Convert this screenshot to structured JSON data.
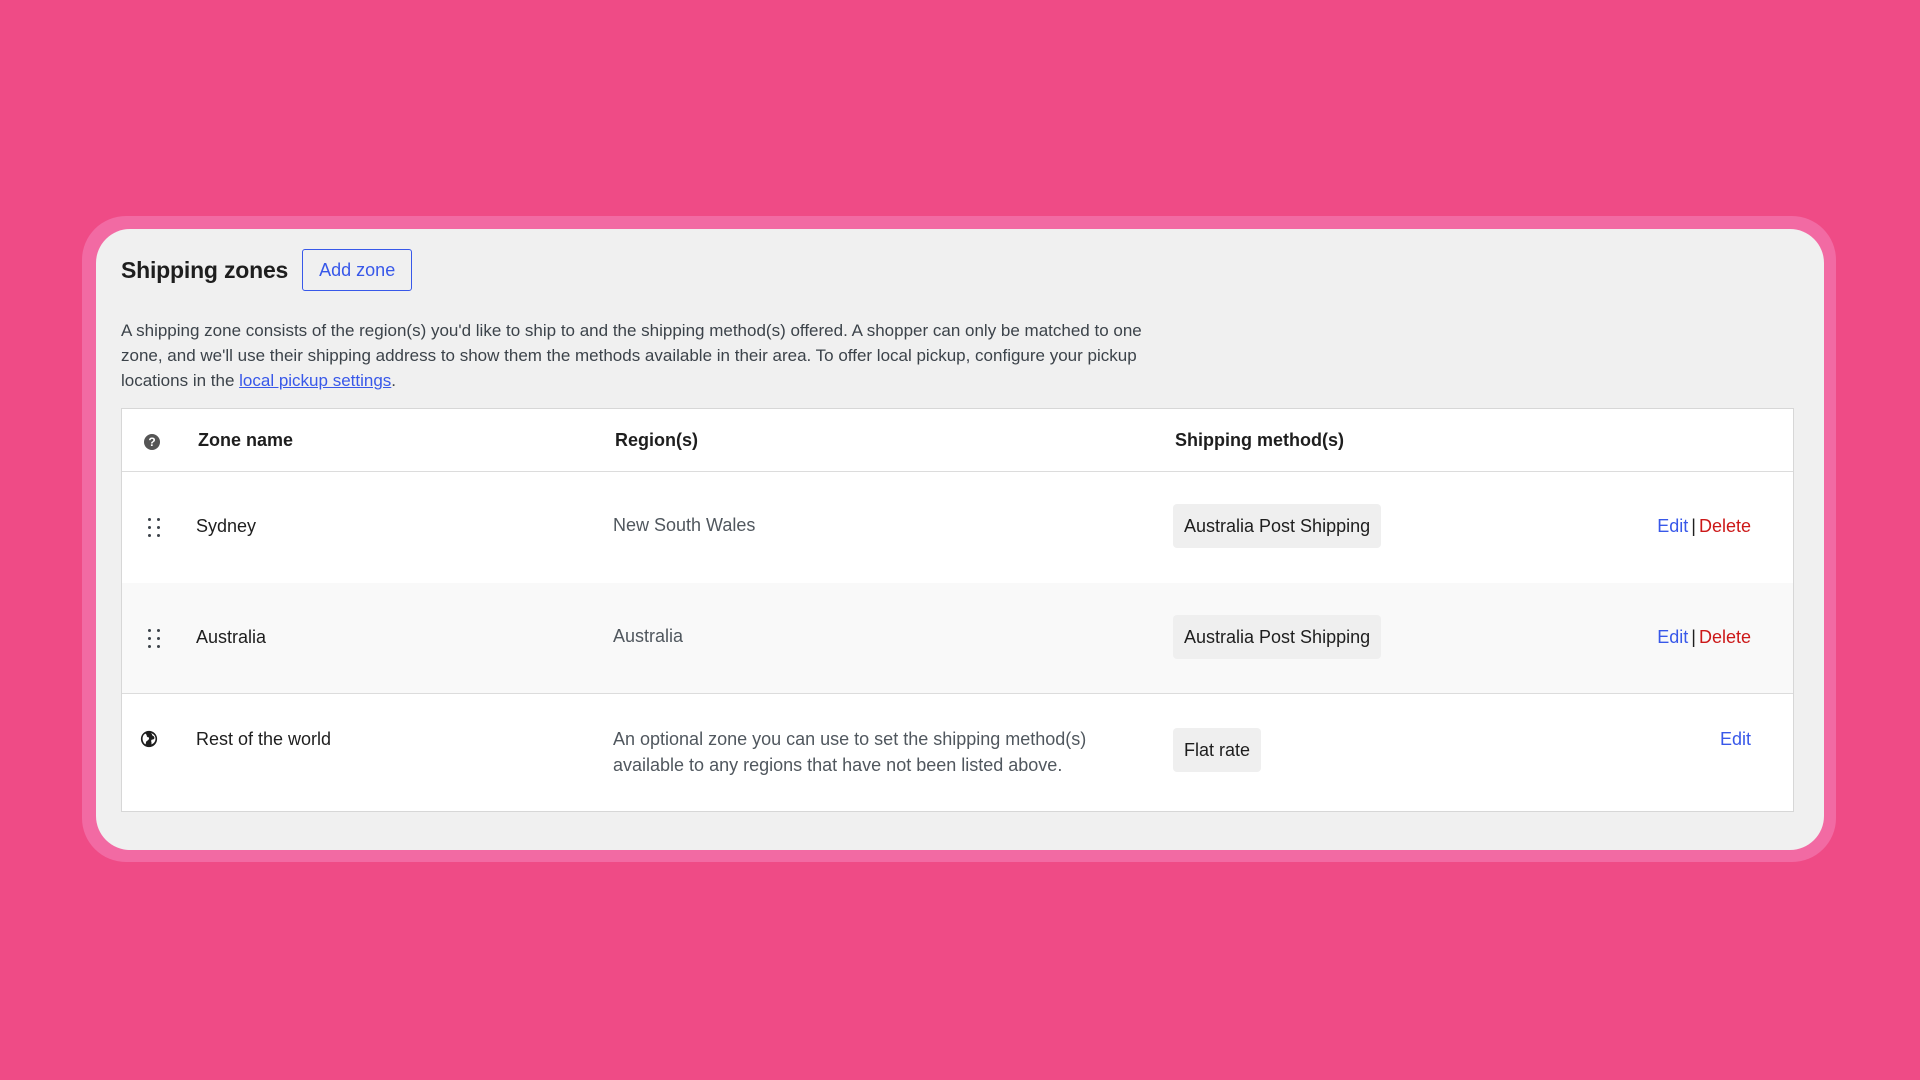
{
  "header": {
    "title": "Shipping zones",
    "add_zone_label": "Add zone"
  },
  "description": {
    "text_before_link": "A shipping zone consists of the region(s) you'd like to ship to and the shipping method(s) offered. A shopper can only be matched to one zone, and we'll use their shipping address to show them the methods available in their area. To offer local pickup, configure your pickup locations in the ",
    "link_text": "local pickup settings",
    "text_after_link": "."
  },
  "table": {
    "columns": {
      "help_icon": "?",
      "zone_name": "Zone name",
      "regions": "Region(s)",
      "methods": "Shipping method(s)"
    },
    "rows": [
      {
        "name": "Sydney",
        "region": "New South Wales",
        "method": "Australia Post Shipping",
        "edit_label": "Edit",
        "separator": "|",
        "delete_label": "Delete"
      },
      {
        "name": "Australia",
        "region": "Australia",
        "method": "Australia Post Shipping",
        "edit_label": "Edit",
        "separator": "|",
        "delete_label": "Delete"
      }
    ],
    "rest_of_world": {
      "name": "Rest of the world",
      "region_line1": "An optional zone you can use to set the shipping method(s)",
      "region_line2": "available to any regions that have not been listed above.",
      "method": "Flat rate",
      "edit_label": "Edit"
    }
  },
  "colors": {
    "background": "#ef4b86",
    "accent": "#3858e9",
    "delete": "#cc1818"
  }
}
